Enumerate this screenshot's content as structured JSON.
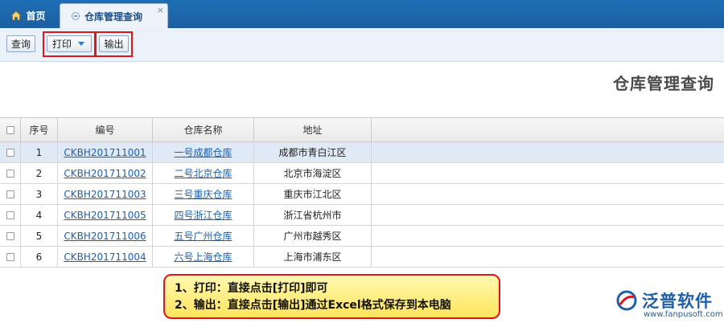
{
  "tabs": {
    "home_label": "首页",
    "active_label": "仓库管理查询",
    "close_glyph": "×"
  },
  "toolbar": {
    "query_label": "查询",
    "print_label": "打印",
    "export_label": "输出"
  },
  "page": {
    "title": "仓库管理查询"
  },
  "table": {
    "headers": {
      "seq": "序号",
      "code": "编号",
      "name": "仓库名称",
      "address": "地址"
    },
    "rows": [
      {
        "seq": "1",
        "code": "CKBH201711001",
        "name": "一号成都仓库",
        "address": "成都市青白江区"
      },
      {
        "seq": "2",
        "code": "CKBH201711002",
        "name": "二号北京仓库",
        "address": "北京市海淀区"
      },
      {
        "seq": "3",
        "code": "CKBH201711003",
        "name": "三号重庆仓库",
        "address": "重庆市江北区"
      },
      {
        "seq": "4",
        "code": "CKBH201711005",
        "name": "四号浙江仓库",
        "address": "浙江省杭州市"
      },
      {
        "seq": "5",
        "code": "CKBH201711006",
        "name": "五号广州仓库",
        "address": "广州市越秀区"
      },
      {
        "seq": "6",
        "code": "CKBH201711004",
        "name": "六号上海仓库",
        "address": "上海市浦东区"
      }
    ]
  },
  "tip": {
    "line1": "1、打印：直接点击[打印]即可",
    "line2": "2、输出：直接点击[输出]通过Excel格式保存到本电脑"
  },
  "logo": {
    "name": "泛普软件",
    "url": "www.fanpusoft.com"
  },
  "colors": {
    "tab_bar": "#1f6fb6",
    "highlight": "#e0141b",
    "link": "#1a5fb4",
    "tip_bg": "#ffe45c"
  }
}
